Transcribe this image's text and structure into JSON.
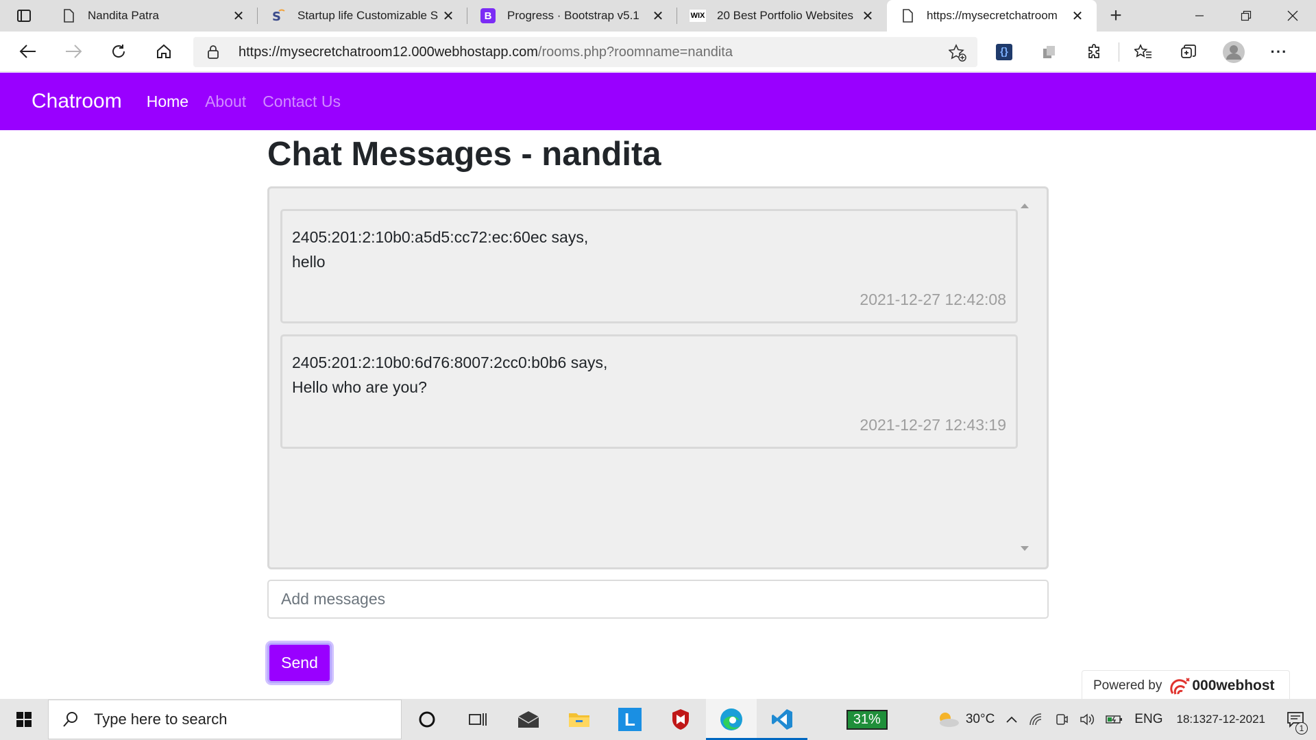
{
  "browser": {
    "tabs": [
      {
        "title": "Nandita Patra",
        "icon": "page-icon",
        "active": false
      },
      {
        "title": "Startup life Customizable S",
        "icon": "s-favicon-icon",
        "active": false
      },
      {
        "title": "Progress · Bootstrap v5.1",
        "icon": "bootstrap-icon",
        "active": false
      },
      {
        "title": "20 Best Portfolio Websites",
        "icon": "wix-icon",
        "active": false
      },
      {
        "title": "https://mysecretchatroom",
        "icon": "page-icon",
        "active": true
      }
    ],
    "wix_label": "WIX",
    "bootstrap_letter": "B",
    "url_host": "https://mysecretchatroom12.000webhostapp.com",
    "url_path": "/rooms.php?roomname=nandita"
  },
  "navbar": {
    "brand": "Chatroom",
    "links": [
      {
        "label": "Home",
        "active": true
      },
      {
        "label": "About",
        "active": false
      },
      {
        "label": "Contact Us",
        "active": false
      }
    ],
    "color": "#9900ff"
  },
  "page": {
    "title": "Chat Messages - nandita",
    "messages": [
      {
        "sender": "2405:201:2:10b0:a5d5:cc72:ec:60ec says,",
        "text": "hello",
        "time": "2021-12-27 12:42:08"
      },
      {
        "sender": "2405:201:2:10b0:6d76:8007:2cc0:b0b6 says,",
        "text": "Hello who are you?",
        "time": "2021-12-27 12:43:19"
      }
    ],
    "input_placeholder": "Add messages",
    "send_label": "Send",
    "powered_by": "Powered by",
    "host_logo": "000webhost"
  },
  "taskbar": {
    "search_placeholder": "Type here to search",
    "battery": "31%",
    "temperature": "30°C",
    "language": "ENG",
    "time": "18:13",
    "date": "27-12-2021",
    "notifications": "1"
  }
}
